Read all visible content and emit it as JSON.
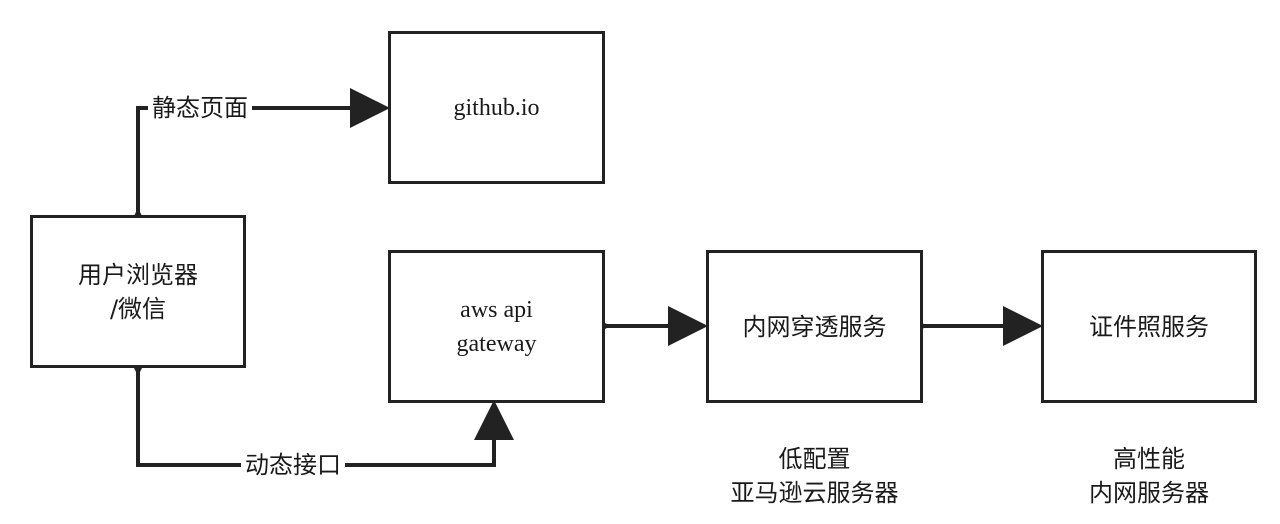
{
  "nodes": {
    "github": {
      "label": "github.io"
    },
    "browser": {
      "line1": "用户浏览器",
      "line2": "/微信"
    },
    "aws": {
      "line1": "aws api",
      "line2": "gateway"
    },
    "tunnel": {
      "label": "内网穿透服务"
    },
    "idphoto": {
      "label": "证件照服务"
    }
  },
  "edges": {
    "static_page": {
      "label": "静态页面"
    },
    "dynamic_api": {
      "label": "动态接口"
    }
  },
  "captions": {
    "low_spec": {
      "line1": "低配置",
      "line2": "亚马逊云服务器"
    },
    "high_perf": {
      "line1": "高性能",
      "line2": "内网服务器"
    }
  }
}
